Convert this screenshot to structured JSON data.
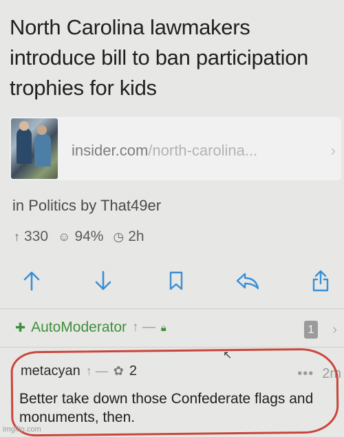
{
  "post": {
    "title": "North Carolina lawmakers introduce bill to ban participation trophies for kids",
    "link": {
      "domain": "insider.com",
      "path": "/north-carolina...",
      "thumbnail_icon": "photo-thumbnail"
    },
    "meta": "in Politics by That49er",
    "stats": {
      "upvotes": "330",
      "ratio": "94%",
      "age": "2h"
    }
  },
  "actions": [
    {
      "name": "upvote",
      "icon": "arrow-up-icon"
    },
    {
      "name": "downvote",
      "icon": "arrow-down-icon"
    },
    {
      "name": "save",
      "icon": "bookmark-icon"
    },
    {
      "name": "reply",
      "icon": "reply-icon"
    },
    {
      "name": "share",
      "icon": "share-icon"
    }
  ],
  "automod": {
    "username": "AutoModerator",
    "score": "—",
    "count": "1"
  },
  "comment": {
    "username": "metacyan",
    "score": "—",
    "awards": "2",
    "age": "2m",
    "body": "Better take down those Confederate flags and monuments, then."
  },
  "colors": {
    "accent": "#3a8ed6",
    "mod_green": "#3f8f3c",
    "circle_red": "#c9453a"
  },
  "watermark": "imgflip.com"
}
